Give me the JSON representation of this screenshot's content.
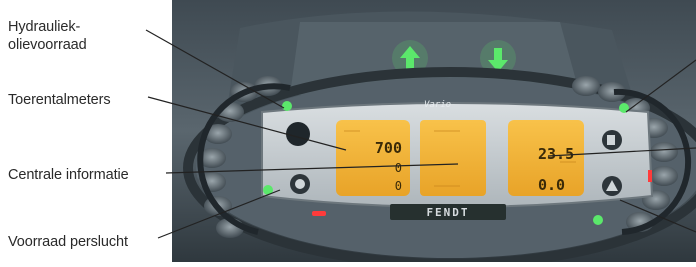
{
  "labels": {
    "hydraulic_line1": "Hydrauliek-",
    "hydraulic_line2": "olievoorraad",
    "rpm": "Toerentalmeters",
    "central": "Centrale informatie",
    "air": "Voorraad perslucht"
  },
  "dashboard": {
    "brand_plate": "FENDT",
    "vario_badge": "Vario",
    "arrows": [
      "up-arrow-icon",
      "down-arrow-icon"
    ],
    "left_display": {
      "top_value": "700",
      "mid_value": "0",
      "bottom_value": "0"
    },
    "right_display": {
      "top_value": "23.5",
      "bottom_value": "0.0"
    },
    "colors": {
      "lcd": "#f6b938",
      "lcd_dark": "#e29a20",
      "led_green": "#5be86b",
      "led_red": "#ff3b3b",
      "bezel": "#4d5a63",
      "panel": "#c9cfd3"
    }
  }
}
